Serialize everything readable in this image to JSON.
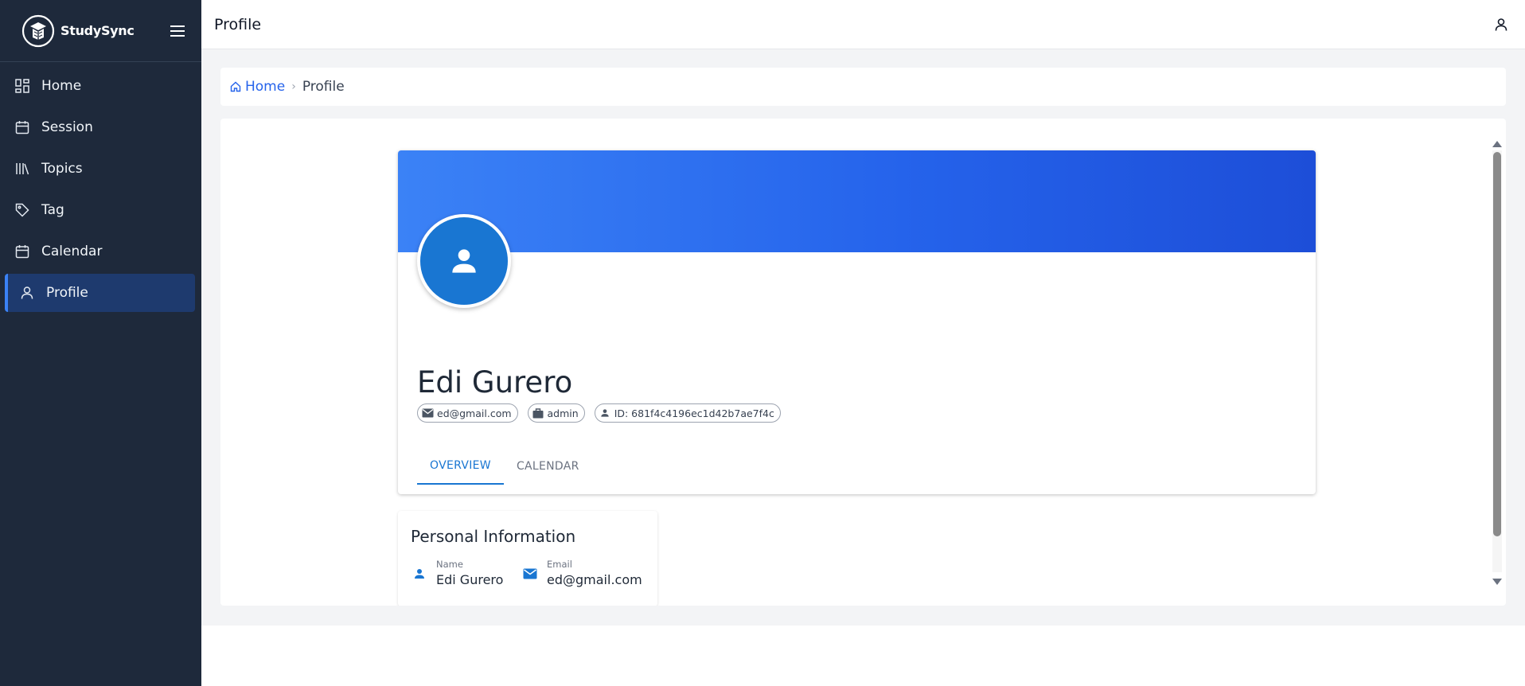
{
  "app": {
    "name": "StudySync"
  },
  "sidebar": {
    "items": [
      {
        "label": "Home",
        "icon": "dashboard-icon",
        "active": false
      },
      {
        "label": "Session",
        "icon": "calendar-icon",
        "active": false
      },
      {
        "label": "Topics",
        "icon": "library-icon",
        "active": false
      },
      {
        "label": "Tag",
        "icon": "tag-icon",
        "active": false
      },
      {
        "label": "Calendar",
        "icon": "calendar-icon",
        "active": false
      },
      {
        "label": "Profile",
        "icon": "user-icon",
        "active": true
      }
    ]
  },
  "topbar": {
    "title": "Profile"
  },
  "breadcrumb": {
    "home": "Home",
    "current": "Profile"
  },
  "profile": {
    "name": "Edi Gurero",
    "chips": {
      "email": "ed@gmail.com",
      "role": "admin",
      "id": "ID: 681f4c4196ec1d42b7ae7f4c"
    },
    "tabs": [
      {
        "label": "OVERVIEW",
        "active": true
      },
      {
        "label": "CALENDAR",
        "active": false
      }
    ]
  },
  "personal_info": {
    "title": "Personal Information",
    "name_label": "Name",
    "name_value": "Edi Gurero",
    "email_label": "Email",
    "email_value": "ed@gmail.com"
  },
  "colors": {
    "sidebar_bg": "#1e293b",
    "accent": "#1976d2",
    "banner_start": "#3b82f6",
    "banner_end": "#1d4ed8",
    "link": "#2563eb"
  }
}
